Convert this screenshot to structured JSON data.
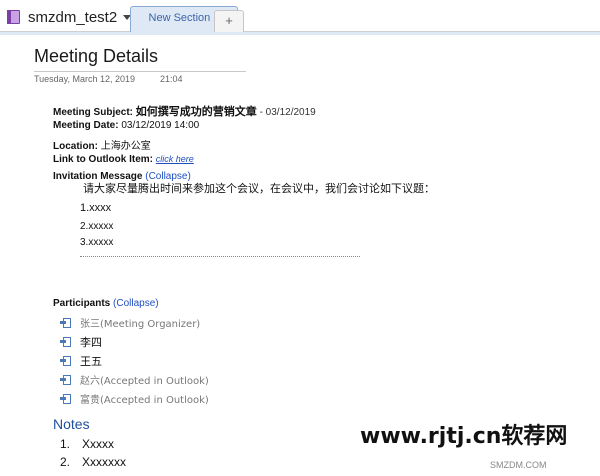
{
  "notebook": {
    "name": "smzdm_test2",
    "icon": "notebook-icon"
  },
  "tabs": {
    "section": "New Section 1",
    "add": "+"
  },
  "page": {
    "title": "Meeting Details",
    "date": "Tuesday, March 12, 2019",
    "time": "21:04"
  },
  "meeting": {
    "subject_label": "Meeting Subject:",
    "subject_value": "如何撰写成功的营销文章",
    "subject_date": "- 03/12/2019",
    "date_label": "Meeting Date:",
    "date_value": "03/12/2019 14:00",
    "location_label": "Location:",
    "location_value": "上海办公室",
    "outlook_label": "Link to Outlook Item:",
    "outlook_link": "click here",
    "invitation_label": "Invitation Message",
    "invitation_toggle": "(Collapse)"
  },
  "invitation": {
    "message": "请大家尽量腾出时间来参加这个会议，在会议中，我们会讨论如下议题：",
    "items": [
      "1.xxxx",
      "2.xxxxx",
      "3.xxxxx"
    ]
  },
  "participants": {
    "label": "Participants",
    "toggle": "(Collapse)",
    "list": [
      {
        "name": "张三(Meeting Organizer)",
        "dim": true
      },
      {
        "name": "李四",
        "dim": false
      },
      {
        "name": "王五",
        "dim": false
      },
      {
        "name": "赵六(Accepted in Outlook)",
        "dim": true
      },
      {
        "name": "富贵(Accepted in Outlook)",
        "dim": true
      }
    ]
  },
  "notes": {
    "title": "Notes",
    "items": [
      {
        "num": "1.",
        "text": "Xxxxx"
      },
      {
        "num": "2.",
        "text": "Xxxxxxx"
      }
    ]
  },
  "watermark": {
    "main": "www.rjtj.cn软荐网",
    "sub": "SMZDM.COM"
  },
  "colors": {
    "accent": "#1f4fbf",
    "tab_bg": "#dfe9f6",
    "notebook": "#7b3fa8"
  }
}
